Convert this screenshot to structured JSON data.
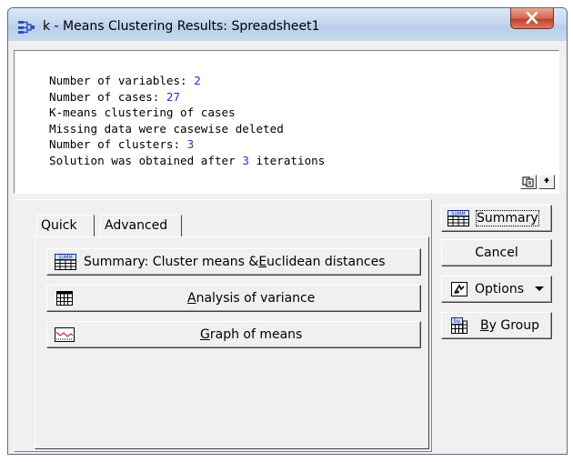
{
  "window": {
    "title": "k - Means Clustering Results: Spreadsheet1"
  },
  "output_lines": [
    {
      "label": "Number of variables:",
      "value": "2",
      "suffix": ""
    },
    {
      "label": "Number of cases:",
      "value": "27",
      "suffix": ""
    },
    {
      "label": "K-means clustering of cases",
      "value": "",
      "suffix": ""
    },
    {
      "label": "Missing data were casewise deleted",
      "value": "",
      "suffix": ""
    },
    {
      "label": "Number of clusters:",
      "value": "3",
      "suffix": ""
    },
    {
      "label": "Solution was obtained after",
      "value": "3",
      "suffix": "iterations"
    }
  ],
  "tabs": [
    {
      "label": "Quick",
      "active": true
    },
    {
      "label": "Advanced",
      "active": false
    }
  ],
  "quick_buttons": {
    "summary_pre": "Summary: Cluster means & ",
    "summary_ul": "E",
    "summary_post": "uclidean distances",
    "anova_ul": "A",
    "anova_post": "nalysis of variance",
    "graph_ul": "G",
    "graph_post": "raph of means"
  },
  "side_buttons": {
    "summary": "Summary",
    "cancel": "Cancel",
    "options": "Options",
    "bygroup_ul": "B",
    "bygroup_post": "y Group"
  },
  "colors": {
    "number_value": "#1a38c8",
    "titlebar": "#c6d9ef",
    "close_button": "#c2402a"
  }
}
